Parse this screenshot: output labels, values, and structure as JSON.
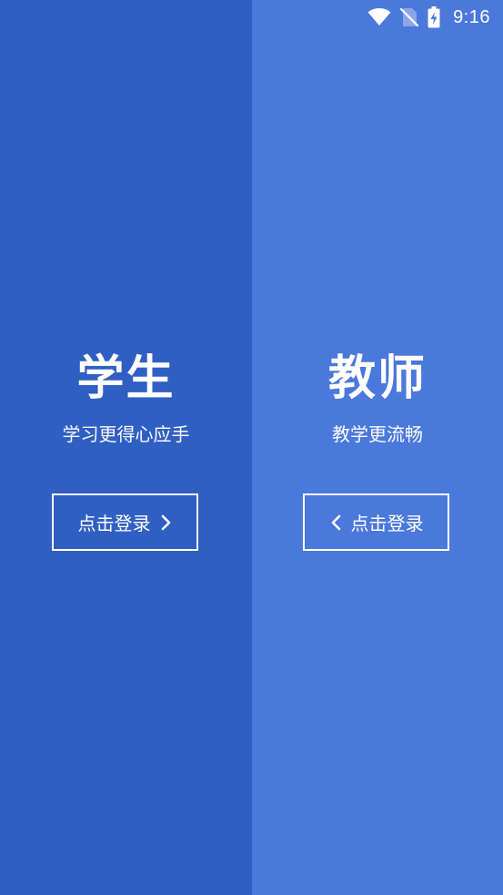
{
  "status_bar": {
    "time": "9:16",
    "icons": [
      "wifi-icon",
      "no-sim-icon",
      "battery-charging-icon"
    ]
  },
  "student": {
    "title": "学生",
    "subtitle": "学习更得心应手",
    "login_label": "点击登录",
    "chevron": "chevron-right-icon"
  },
  "teacher": {
    "title": "教师",
    "subtitle": "教学更流畅",
    "login_label": "点击登录",
    "chevron": "chevron-left-icon"
  },
  "colors": {
    "student_panel": "#2f5fc3",
    "teacher_panel": "#4a78db",
    "foreground": "#ffffff"
  }
}
